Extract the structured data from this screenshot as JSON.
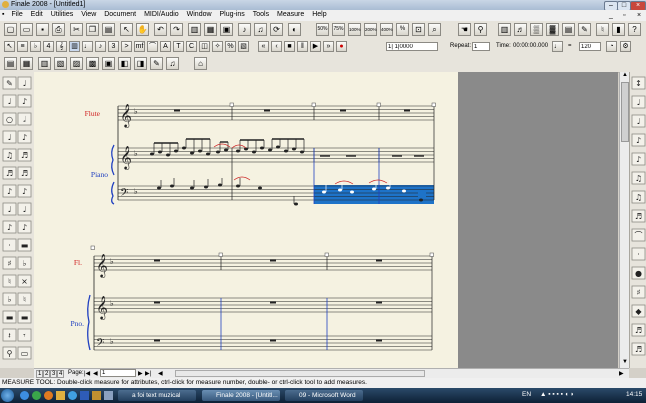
{
  "window": {
    "title": "Finale 2008 - [Untitled1]"
  },
  "menu": [
    "File",
    "Edit",
    "Utilities",
    "View",
    "Document",
    "MIDI/Audio",
    "Window",
    "Plug-ins",
    "Tools",
    "Measure",
    "Help"
  ],
  "zoom_buttons": [
    "50%",
    "75%",
    "100%",
    "200%",
    "400%",
    "%"
  ],
  "playback": {
    "measure_value": "1| 1|0000",
    "repeat_label": "Repeat:",
    "repeat_value": "1",
    "time_label": "Time:",
    "time_value": "00:00:00.000",
    "tempo_value": "120"
  },
  "score": {
    "system1": {
      "staves": [
        {
          "name": "Flute"
        },
        {
          "name": "Piano"
        }
      ]
    },
    "system2": {
      "staves": [
        {
          "name": "Fl."
        },
        {
          "name": "Pno."
        }
      ]
    },
    "colors": {
      "instrument_name": "#d02020",
      "piano_name": "#2040c0",
      "selection": "#1e73c8",
      "slur": "#cc2020"
    }
  },
  "page_bar": {
    "pages": [
      "1",
      "2",
      "3",
      "4"
    ],
    "page_label": "Page:",
    "page_value": "1"
  },
  "status_text": "MEASURE TOOL: Double-click measure for attributes, ctrl-click for measure number, double- or ctrl-click tool to add measures.",
  "taskbar": {
    "tasks": [
      "a foi text muzical",
      "Finale 2008 - [Untitl...",
      "09 - Microsoft Word"
    ],
    "language": "EN",
    "clock": "14:15"
  }
}
